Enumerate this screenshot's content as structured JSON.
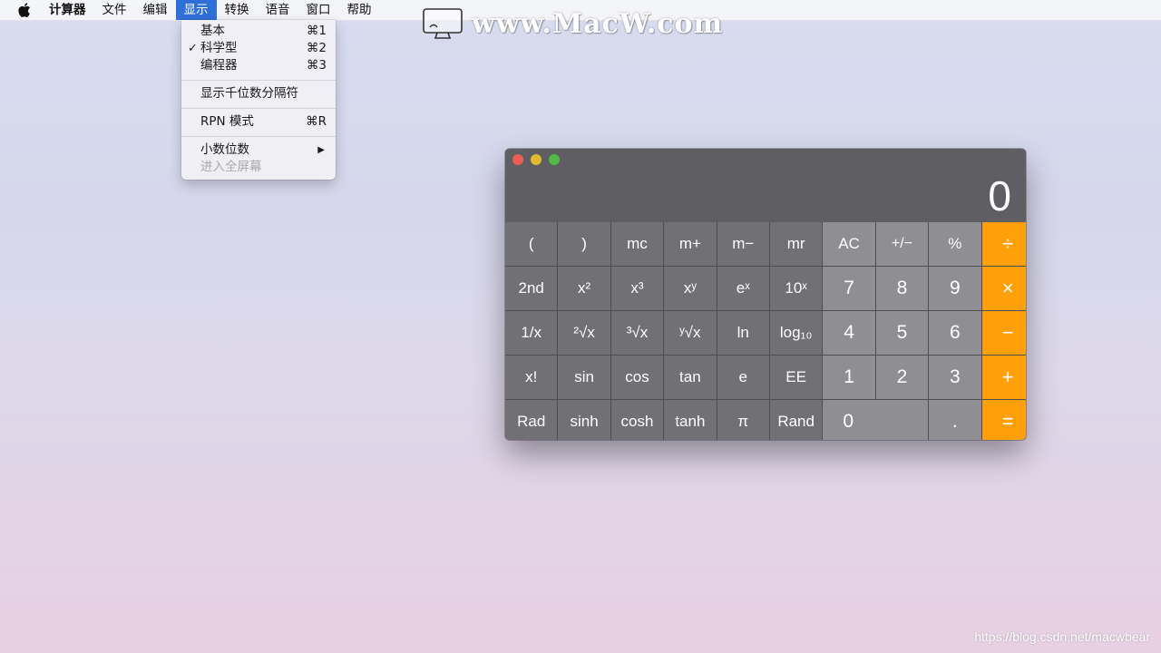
{
  "menubar": {
    "items": [
      "计算器",
      "文件",
      "编辑",
      "显示",
      "转换",
      "语音",
      "窗口",
      "帮助"
    ],
    "active_index": 3
  },
  "display_menu": {
    "items": [
      {
        "label": "基本",
        "shortcut": "⌘1",
        "checked": false
      },
      {
        "label": "科学型",
        "shortcut": "⌘2",
        "checked": true
      },
      {
        "label": "编程器",
        "shortcut": "⌘3",
        "checked": false
      },
      {
        "label": "显示千位数分隔符"
      },
      {
        "label": "RPN 模式",
        "shortcut": "⌘R"
      },
      {
        "label": "小数位数",
        "submenu": true
      },
      {
        "label": "进入全屏幕",
        "disabled": true
      }
    ],
    "check_glyph": "✓",
    "submenu_glyph": "▶"
  },
  "watermark": {
    "text": "www.MacW.com"
  },
  "footer_watermark": "https://blog.csdn.net/macwbear",
  "calculator": {
    "display": "0",
    "rows": [
      [
        "(",
        ")",
        "mc",
        "m+",
        "m−",
        "mr",
        "AC",
        "+/−",
        "%",
        "÷"
      ],
      [
        "2nd",
        "x²",
        "x³",
        "xʸ",
        "eˣ",
        "10ˣ",
        "7",
        "8",
        "9",
        "×"
      ],
      [
        "1/x",
        "²√x",
        "³√x",
        "ʸ√x",
        "ln",
        "log₁₀",
        "4",
        "5",
        "6",
        "−"
      ],
      [
        "x!",
        "sin",
        "cos",
        "tan",
        "e",
        "EE",
        "1",
        "2",
        "3",
        "+"
      ],
      [
        "Rad",
        "sinh",
        "cosh",
        "tanh",
        "π",
        "Rand",
        "0",
        ".",
        "="
      ]
    ],
    "colors": {
      "function_key": "#707075",
      "number_key": "#8f8f93",
      "operator_key": "#ff9f0a",
      "display_bg": "#5e5e63"
    }
  }
}
